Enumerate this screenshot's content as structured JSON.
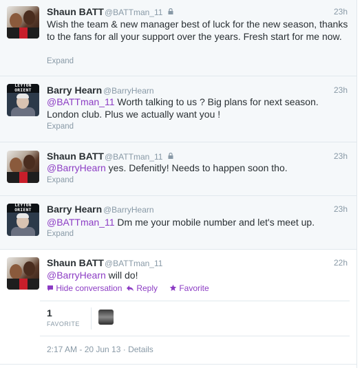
{
  "tweets": [
    {
      "fullname": "Shaun BATT",
      "handle": "@BATTman_11",
      "time": "23h",
      "text": "Wish the team & new manager best of luck for the new season, thanks to the fans for all your support over the years. Fresh start for me now.",
      "expand": "Expand"
    },
    {
      "fullname": "Barry Hearn",
      "handle": "@BarryHearn",
      "time": "23h",
      "mention": "@BATTman_11",
      "text": " Worth talking to us ? Big plans for next season. London club. Plus we actually want you !",
      "expand": "Expand"
    },
    {
      "fullname": "Shaun BATT",
      "handle": "@BATTman_11",
      "time": "23h",
      "mention": "@BarryHearn",
      "text": " yes. Defenitly! Needs to happen soon tho.",
      "expand": "Expand"
    },
    {
      "fullname": "Barry Hearn",
      "handle": "@BarryHearn",
      "time": "23h",
      "mention": "@BATTman_11",
      "text": " Dm me your mobile number and let's meet up.",
      "expand": "Expand"
    },
    {
      "fullname": "Shaun BATT",
      "handle": "@BATTman_11",
      "time": "22h",
      "mention": "@BarryHearn",
      "text": " will do!"
    }
  ],
  "avatars": {
    "barry_banner": "LEYTON ORIENT"
  },
  "actions": {
    "hide": "Hide conversation",
    "reply": "Reply",
    "favorite": "Favorite"
  },
  "stats": {
    "count": "1",
    "label": "FAVORITE"
  },
  "meta": {
    "timestamp": "2:17 AM - 20 Jun 13",
    "separator": "·",
    "details": "Details"
  },
  "colors": {
    "link": "#8c3cc4",
    "muted": "#8899a6",
    "text": "#292f33",
    "expanded_bg": "#f5f8fa"
  }
}
